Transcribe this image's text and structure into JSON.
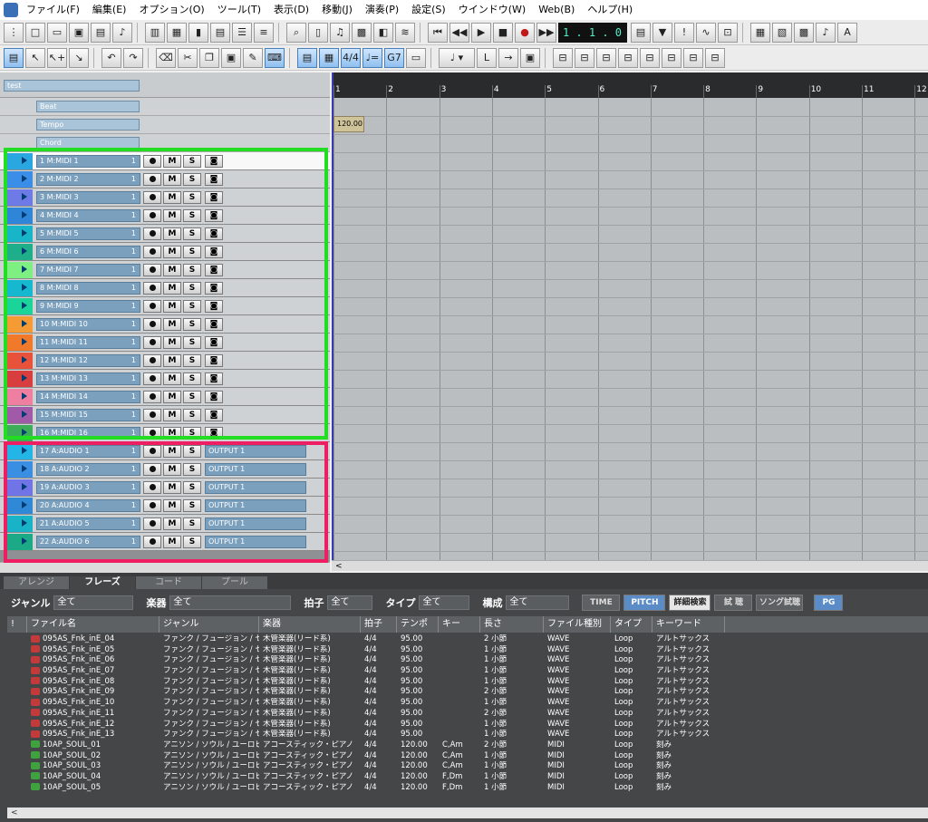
{
  "menu": {
    "items": [
      "ファイル(F)",
      "編集(E)",
      "オプション(O)",
      "ツール(T)",
      "表示(D)",
      "移動(J)",
      "演奏(P)",
      "設定(S)",
      "ウインドウ(W)",
      "Web(B)",
      "ヘルプ(H)"
    ]
  },
  "transport": {
    "position": "1 . 1 .   0"
  },
  "toolbar2": {
    "time_sig": "4/4",
    "tempo_btn": "♩=",
    "chord_btn": "G7"
  },
  "tracks_panel": {
    "header_name": "test",
    "special_rows": [
      "Beat",
      "Tempo",
      "Chord"
    ],
    "midi_tracks": [
      {
        "label": "1 M:MIDI 1",
        "ch": "1",
        "color": "#2aa6e0"
      },
      {
        "label": "2 M:MIDI 2",
        "ch": "1",
        "color": "#3b8ee8"
      },
      {
        "label": "3 M:MIDI 3",
        "ch": "1",
        "color": "#6e7be6"
      },
      {
        "label": "4 M:MIDI 4",
        "ch": "1",
        "color": "#2f85d8"
      },
      {
        "label": "5 M:MIDI 5",
        "ch": "1",
        "color": "#18b5c9"
      },
      {
        "label": "6 M:MIDI 6",
        "ch": "1",
        "color": "#1fae8a"
      },
      {
        "label": "7 M:MIDI 7",
        "ch": "1",
        "color": "#7ef082"
      },
      {
        "label": "8 M:MIDI 8",
        "ch": "1",
        "color": "#16b8d0"
      },
      {
        "label": "9 M:MIDI 9",
        "ch": "1",
        "color": "#1bd49a"
      },
      {
        "label": "10 M:MIDI 10",
        "ch": "1",
        "color": "#f59b34"
      },
      {
        "label": "11 M:MIDI 11",
        "ch": "1",
        "color": "#f07a2a"
      },
      {
        "label": "12 M:MIDI 12",
        "ch": "1",
        "color": "#e8513a"
      },
      {
        "label": "13 M:MIDI 13",
        "ch": "1",
        "color": "#d83e3e"
      },
      {
        "label": "14 M:MIDI 14",
        "ch": "1",
        "color": "#ef7fa0"
      },
      {
        "label": "15 M:MIDI 15",
        "ch": "1",
        "color": "#a05aa8"
      },
      {
        "label": "16 M:MIDI 16",
        "ch": "1",
        "color": "#3cae58"
      }
    ],
    "audio_tracks": [
      {
        "label": "17 A:AUDIO 1",
        "ch": "1",
        "output": "OUTPUT 1",
        "color": "#22b5e6"
      },
      {
        "label": "18 A:AUDIO 2",
        "ch": "1",
        "output": "OUTPUT 1",
        "color": "#3a8fe2"
      },
      {
        "label": "19 A:AUDIO 3",
        "ch": "1",
        "output": "OUTPUT 1",
        "color": "#7174e4"
      },
      {
        "label": "20 A:AUDIO 4",
        "ch": "1",
        "output": "OUTPUT 1",
        "color": "#2f89d6"
      },
      {
        "label": "21 A:AUDIO 5",
        "ch": "1",
        "output": "OUTPUT 1",
        "color": "#18b3c6"
      },
      {
        "label": "22 A:AUDIO 6",
        "ch": "1",
        "output": "OUTPUT 1",
        "color": "#1caa86"
      }
    ],
    "button_labels": {
      "mute": "M",
      "solo": "S"
    }
  },
  "arrange": {
    "bars": [
      "1",
      "2",
      "3",
      "4",
      "5",
      "6",
      "7",
      "8",
      "9",
      "10",
      "11",
      "12"
    ],
    "tempo_value": "120.00"
  },
  "bottom": {
    "tabs": [
      "アレンジ",
      "フレーズ",
      "コード",
      "プール"
    ],
    "active_tab": "フレーズ",
    "filters": {
      "genre_label": "ジャンル",
      "genre_value": "全て",
      "instrument_label": "楽器",
      "instrument_value": "全て",
      "meter_label": "拍子",
      "meter_value": "全て",
      "type_label": "タイプ",
      "type_value": "全て",
      "structure_label": "構成",
      "structure_value": "全て"
    },
    "buttons": {
      "time": "TIME",
      "pitch": "PITCH",
      "detail_search": "詳細検索",
      "trial": "試 聴",
      "song_trial": "ソング試聴",
      "pg": "PG"
    },
    "columns": [
      "!",
      "ファイル名",
      "ジャンル",
      "楽器",
      "拍子",
      "テンポ",
      "キー",
      "長さ",
      "ファイル種別",
      "タイプ",
      "キーワード"
    ],
    "rows": [
      {
        "kind": "wave",
        "file": "095AS_Fnk_inE_04",
        "genre": "ファンク / フュージョン / セカ...",
        "inst": "木管楽器(リード系)",
        "meter": "4/4",
        "tempo": "95.00",
        "key": "",
        "length": "2 小節",
        "ftype": "WAVE",
        "type": "Loop",
        "kw": "アルトサックス"
      },
      {
        "kind": "wave",
        "file": "095AS_Fnk_inE_05",
        "genre": "ファンク / フュージョン / セカ...",
        "inst": "木管楽器(リード系)",
        "meter": "4/4",
        "tempo": "95.00",
        "key": "",
        "length": "1 小節",
        "ftype": "WAVE",
        "type": "Loop",
        "kw": "アルトサックス"
      },
      {
        "kind": "wave",
        "file": "095AS_Fnk_inE_06",
        "genre": "ファンク / フュージョン / セカ...",
        "inst": "木管楽器(リード系)",
        "meter": "4/4",
        "tempo": "95.00",
        "key": "",
        "length": "1 小節",
        "ftype": "WAVE",
        "type": "Loop",
        "kw": "アルトサックス"
      },
      {
        "kind": "wave",
        "file": "095AS_Fnk_inE_07",
        "genre": "ファンク / フュージョン / セカ...",
        "inst": "木管楽器(リード系)",
        "meter": "4/4",
        "tempo": "95.00",
        "key": "",
        "length": "1 小節",
        "ftype": "WAVE",
        "type": "Loop",
        "kw": "アルトサックス"
      },
      {
        "kind": "wave",
        "file": "095AS_Fnk_inE_08",
        "genre": "ファンク / フュージョン / セカ...",
        "inst": "木管楽器(リード系)",
        "meter": "4/4",
        "tempo": "95.00",
        "key": "",
        "length": "1 小節",
        "ftype": "WAVE",
        "type": "Loop",
        "kw": "アルトサックス"
      },
      {
        "kind": "wave",
        "file": "095AS_Fnk_inE_09",
        "genre": "ファンク / フュージョン / セカ...",
        "inst": "木管楽器(リード系)",
        "meter": "4/4",
        "tempo": "95.00",
        "key": "",
        "length": "2 小節",
        "ftype": "WAVE",
        "type": "Loop",
        "kw": "アルトサックス"
      },
      {
        "kind": "wave",
        "file": "095AS_Fnk_inE_10",
        "genre": "ファンク / フュージョン / セカ...",
        "inst": "木管楽器(リード系)",
        "meter": "4/4",
        "tempo": "95.00",
        "key": "",
        "length": "1 小節",
        "ftype": "WAVE",
        "type": "Loop",
        "kw": "アルトサックス"
      },
      {
        "kind": "wave",
        "file": "095AS_Fnk_inE_11",
        "genre": "ファンク / フュージョン / セカ...",
        "inst": "木管楽器(リード系)",
        "meter": "4/4",
        "tempo": "95.00",
        "key": "",
        "length": "2 小節",
        "ftype": "WAVE",
        "type": "Loop",
        "kw": "アルトサックス"
      },
      {
        "kind": "wave",
        "file": "095AS_Fnk_inE_12",
        "genre": "ファンク / フュージョン / セカ...",
        "inst": "木管楽器(リード系)",
        "meter": "4/4",
        "tempo": "95.00",
        "key": "",
        "length": "1 小節",
        "ftype": "WAVE",
        "type": "Loop",
        "kw": "アルトサックス"
      },
      {
        "kind": "wave",
        "file": "095AS_Fnk_inE_13",
        "genre": "ファンク / フュージョン / セカ...",
        "inst": "木管楽器(リード系)",
        "meter": "4/4",
        "tempo": "95.00",
        "key": "",
        "length": "1 小節",
        "ftype": "WAVE",
        "type": "Loop",
        "kw": "アルトサックス"
      },
      {
        "kind": "midi",
        "file": "10AP_SOUL_01",
        "genre": "アニソン / ソウル / ユーロビ...",
        "inst": "アコースティック・ピアノ",
        "meter": "4/4",
        "tempo": "120.00",
        "key": "C,Am",
        "length": "2 小節",
        "ftype": "MIDI",
        "type": "Loop",
        "kw": "刻み"
      },
      {
        "kind": "midi",
        "file": "10AP_SOUL_02",
        "genre": "アニソン / ソウル / ユーロビ...",
        "inst": "アコースティック・ピアノ",
        "meter": "4/4",
        "tempo": "120.00",
        "key": "C,Am",
        "length": "1 小節",
        "ftype": "MIDI",
        "type": "Loop",
        "kw": "刻み"
      },
      {
        "kind": "midi",
        "file": "10AP_SOUL_03",
        "genre": "アニソン / ソウル / ユーロビ...",
        "inst": "アコースティック・ピアノ",
        "meter": "4/4",
        "tempo": "120.00",
        "key": "C,Am",
        "length": "1 小節",
        "ftype": "MIDI",
        "type": "Loop",
        "kw": "刻み"
      },
      {
        "kind": "midi",
        "file": "10AP_SOUL_04",
        "genre": "アニソン / ソウル / ユーロビ...",
        "inst": "アコースティック・ピアノ",
        "meter": "4/4",
        "tempo": "120.00",
        "key": "F,Dm",
        "length": "1 小節",
        "ftype": "MIDI",
        "type": "Loop",
        "kw": "刻み"
      },
      {
        "kind": "midi",
        "file": "10AP_SOUL_05",
        "genre": "アニソン / ソウル / ユーロビ...",
        "inst": "アコースティック・ピアノ",
        "meter": "4/4",
        "tempo": "120.00",
        "key": "F,Dm",
        "length": "1 小節",
        "ftype": "MIDI",
        "type": "Loop",
        "kw": "刻み"
      }
    ]
  }
}
